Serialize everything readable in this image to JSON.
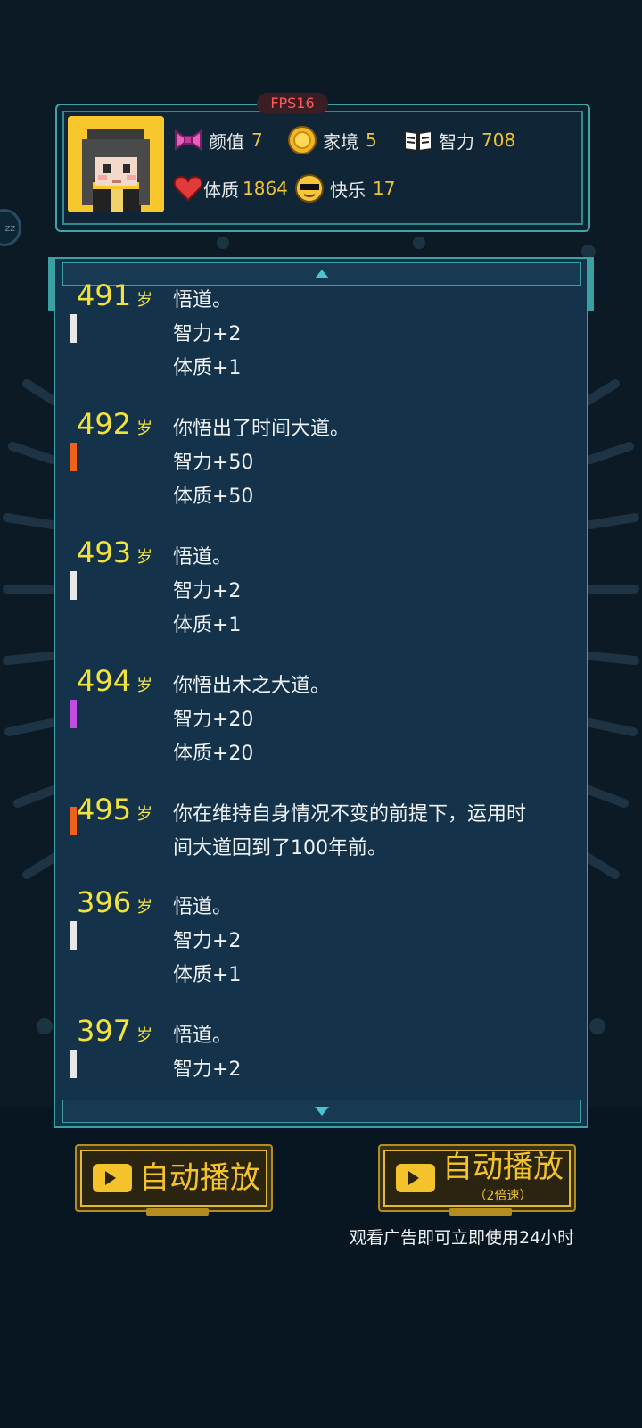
{
  "fps": "FPS16",
  "stats": {
    "appearance": {
      "label": "颜值",
      "value": "7"
    },
    "family": {
      "label": "家境",
      "value": "5"
    },
    "intelligence": {
      "label": "智力",
      "value": "708"
    },
    "physique": {
      "label": "体质",
      "value": "1864"
    },
    "happiness": {
      "label": "快乐",
      "value": "17"
    }
  },
  "side_bubble": "zz",
  "age_unit": "岁",
  "log": [
    {
      "age": "491",
      "marker_color": "#e8e8e8",
      "lines": [
        "悟道。",
        "智力+2",
        "体质+1"
      ]
    },
    {
      "age": "492",
      "marker_color": "#f0621a",
      "lines": [
        "你悟出了时间大道。",
        "智力+50",
        "体质+50"
      ]
    },
    {
      "age": "493",
      "marker_color": "#e8e8e8",
      "lines": [
        "悟道。",
        "智力+2",
        "体质+1"
      ]
    },
    {
      "age": "494",
      "marker_color": "#c24de0",
      "lines": [
        "你悟出木之大道。",
        "智力+20",
        "体质+20"
      ]
    },
    {
      "age": "495",
      "marker_color": "#f0621a",
      "lines": [
        "你在维持自身情况不变的前提下，运用时",
        "间大道回到了100年前。"
      ]
    },
    {
      "age": "396",
      "marker_color": "#e8e8e8",
      "lines": [
        "悟道。",
        "智力+2",
        "体质+1"
      ]
    },
    {
      "age": "397",
      "marker_color": "#e8e8e8",
      "lines": [
        "悟道。",
        "智力+2"
      ]
    }
  ],
  "buttons": {
    "auto_play": {
      "label": "自动播放"
    },
    "auto_play_2x": {
      "label": "自动播放",
      "sub": "（2倍速）"
    }
  },
  "ad_note": "观看广告即可立即使用24小时",
  "colors": {
    "accent": "#3aa0a3",
    "gold": "#f4c32c",
    "age_yellow": "#f2e23c"
  }
}
